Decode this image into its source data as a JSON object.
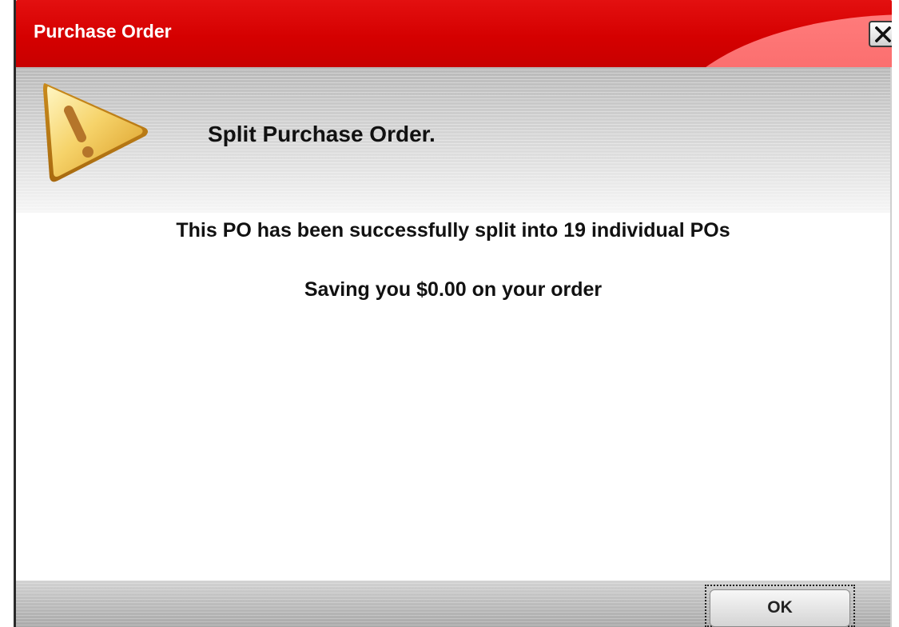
{
  "window": {
    "title": "Purchase Order",
    "close_icon": "close-x-icon"
  },
  "header": {
    "icon": "warning-triangle-icon",
    "heading": "Split Purchase Order."
  },
  "body": {
    "message_line1": "This PO has been successfully split into 19 individual POs",
    "message_line2": "Saving you $0.00 on your order"
  },
  "footer": {
    "ok_label": "OK"
  },
  "colors": {
    "titlebar": "#d50000",
    "title_text": "#ffffff",
    "warning_icon": "#f2c94c"
  }
}
